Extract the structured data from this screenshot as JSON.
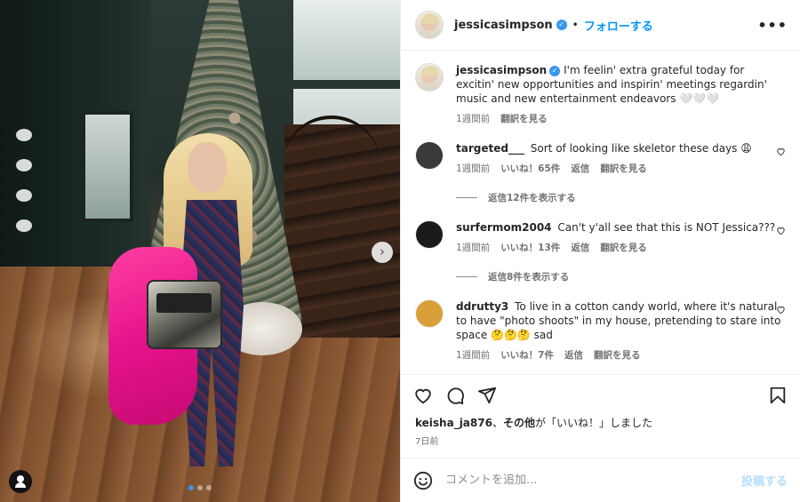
{
  "photo": {
    "next_label": "›",
    "slides_total": 3,
    "slide_active": 1
  },
  "header": {
    "username": "jessicasimpson",
    "verified": true,
    "separator": "•",
    "follow_label": "フォローする",
    "more_label": "•••"
  },
  "caption": {
    "username": "jessicasimpson",
    "text": "I'm feelin' extra grateful today for excitin' new opportunities and inspirin' meetings regardin' music and new entertainment endeavors 🤍🤍🤍",
    "time": "1週間前",
    "translate": "翻訳を見る"
  },
  "comments": [
    {
      "username": "targeted___",
      "text": "Sort of looking like skeletor these days 😩",
      "time": "1週間前",
      "likes": "いいね！65件",
      "reply": "返信",
      "translate": "翻訳を見る",
      "replies": "返信12件を表示する",
      "avatar_color": "#3a3a3a"
    },
    {
      "username": "surfermom2004",
      "text": "Can't y'all see that this is NOT Jessica???",
      "time": "1週間前",
      "likes": "いいね！13件",
      "reply": "返信",
      "translate": "翻訳を見る",
      "replies": "返信8件を表示する",
      "avatar_color": "#1b1b1b"
    },
    {
      "username": "ddrutty3",
      "text": "To live in a cotton candy world, where it's natural to have \"photo shoots\" in my house, pretending to stare into space 🤔🤔🤔 sad",
      "time": "1週間前",
      "likes": "いいね！7件",
      "reply": "返信",
      "translate": "翻訳を見る",
      "avatar_color": "#d9a03a"
    }
  ],
  "likes_line": {
    "user": "keisha_ja876",
    "sep": "、",
    "others": "その他",
    "suffix": "が「いいね！」しました"
  },
  "date": "7日前",
  "compose": {
    "placeholder": "コメントを追加...",
    "post_label": "投稿する"
  },
  "colors": {
    "accent": "#0095f6",
    "muted": "#737373"
  }
}
